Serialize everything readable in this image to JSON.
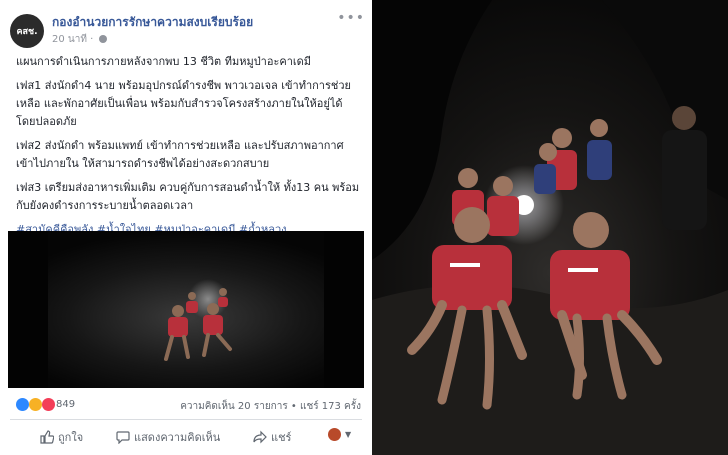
{
  "post": {
    "page_name": "กองอำนวยการรักษาความสงบเรียบร้อย",
    "avatar_label": "คสช.",
    "timestamp": "20 นาที",
    "more_label": "•••",
    "paragraphs": [
      "แผนการดำเนินการภายหลังจากพบ 13 ชีวิต ทีมหมูป่าอะคาเดมี",
      "เฟส1 ส่งนักดำ4 นาย พร้อมอุปกรณ์ดำรงชีพ พาวเวอเจล เข้าทำการช่วยเหลือ และพักอาศัยเป็นเพื่อน พร้อมกับสำรวจโครงสร้างภายในให้อยู่ได้โดยปลอดภัย",
      "เฟส2 ส่งนักดำ พร้อมแพทย์ เข้าทำการช่วยเหลือ และปรับสภาพอากาศเข้าไปภายใน ให้สามารถดำรงชีพได้อย่างสะดวกสบาย",
      "เฟส3 เตรียมส่งอาหารเพิ่มเติม ควบคู่กับการสอนดำน้ำให้ ทั้ง13 คน พร้อมกับยังคงดำรงการระบายน้ำตลอดเวลา"
    ],
    "hashtags": "#สามัคคีคือพลัง #น้ำใจไทย #หมูป่าอะคาเดมี #ถ้ำหลวง"
  },
  "stats": {
    "reaction_count": "849",
    "comments": "ความคิดเห็น 20 รายการ",
    "separator": "•",
    "shares": "แชร์ 173 ครั้ง"
  },
  "actions": {
    "like": "ถูกใจ",
    "comment": "แสดงความคิดเห็น",
    "share": "แชร์"
  },
  "colors": {
    "link": "#385898",
    "like_blue": "#2d88ff",
    "love_red": "#f33e58",
    "wow_yellow": "#f7b125",
    "jersey_red": "#c8313d"
  },
  "icons": [
    "globe-icon",
    "more-icon",
    "like-icon",
    "comment-icon",
    "share-icon"
  ]
}
